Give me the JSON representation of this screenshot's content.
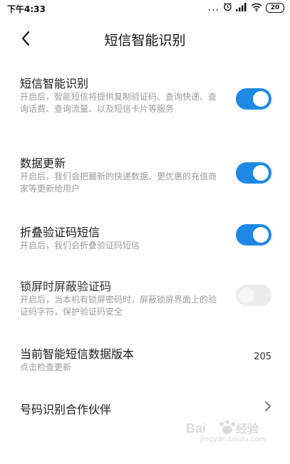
{
  "status_bar": {
    "time": "下午4:33",
    "dots": "...",
    "battery": "20"
  },
  "header": {
    "title": "短信智能识别"
  },
  "settings": [
    {
      "title": "短信智能识别",
      "desc": "开启后，智能短信将提供复制验证码、查询快递、查询话费、查询流量、以及短信卡片等服务",
      "toggle": "on"
    },
    {
      "title": "数据更新",
      "desc": "开启后，我们会把最新的快递数据、更优惠的充值商家等更新给用户",
      "toggle": "on"
    },
    {
      "title": "折叠验证码短信",
      "desc": "开启后，我们会折叠验证码短信",
      "toggle": "on"
    },
    {
      "title": "锁屏时屏蔽验证码",
      "desc": "开启后，当本机有锁屏密码时，屏蔽锁屏界面上的验证码字符，保护验证码安全",
      "toggle": "off"
    }
  ],
  "version_row": {
    "title": "当前智能短信数据版本",
    "desc": "点击检查更新",
    "value": "205"
  },
  "partner_row": {
    "title": "号码识别合作伙伴"
  },
  "watermark": {
    "text": "jingyan.baidu.com"
  },
  "colors": {
    "accent": "#1e88e5",
    "toggle_off": "#ececec",
    "desc_text": "#9a9a9a"
  }
}
